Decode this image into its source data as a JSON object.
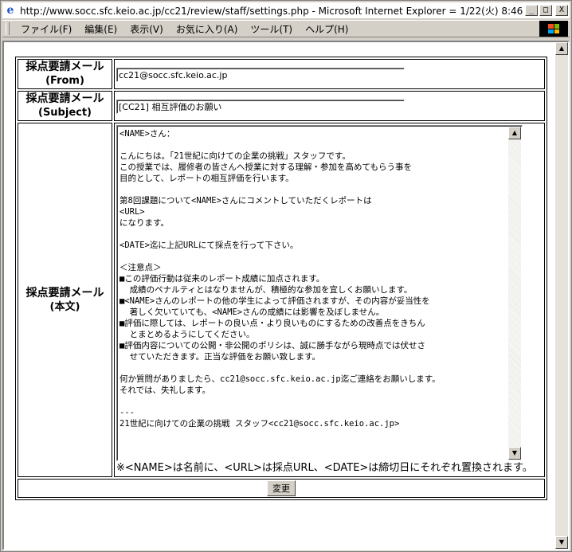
{
  "window": {
    "title": "http://www.socc.sfc.keio.ac.jp/cc21/review/staff/settings.php - Microsoft Internet Explorer = 1/22(火) 8:46",
    "minimize": "_",
    "maximize": "□",
    "close": "X"
  },
  "menu": {
    "items": [
      "ファイル(F)",
      "編集(E)",
      "表示(V)",
      "お気に入り(A)",
      "ツール(T)",
      "ヘルプ(H)"
    ]
  },
  "form": {
    "from_label": "採点要請メール",
    "from_sub": "(From)",
    "from_value": "cc21@socc.sfc.keio.ac.jp",
    "subject_label": "採点要請メール",
    "subject_sub": "(Subject)",
    "subject_value": "[CC21] 相互評価のお願い",
    "body_label": "採点要請メール",
    "body_sub": "(本文)",
    "body_value": "<NAME>さん：\n\nこんにちは。「21世紀に向けての企業の挑戦」スタッフです。\nこの授業では、履修者の皆さんへ授業に対する理解・参加を高めてもらう事を\n目的として、レポートの相互評価を行います。\n\n第8回課題について<NAME>さんにコメントしていただくレポートは\n<URL>\nになります。\n\n<DATE>迄に上記URLにて採点を行って下さい。\n\n＜注意点＞\n■この評価行動は従来のレポート成績に加点されます。\n  成績のペナルティとはなりませんが、積極的な参加を宜しくお願いします。\n■<NAME>さんのレポートの他の学生によって評価されますが、その内容が妥当性を\n  著しく欠いていても、<NAME>さんの成績には影響を及ぼしません。\n■評価に際しては、レポートの良い点・より良いものにするための改善点をきちん\n  とまとめるようにしてください。\n■評価内容についての公開・非公開のポリシは、誠に勝手ながら現時点では伏せさ\n  せていただきます。正当な評価をお願い致します。\n\n何か質問がありましたら、cc21@socc.sfc.keio.ac.jp迄ご連絡をお願いします。\nそれでは、失礼します。\n\n---\n21世紀に向けての企業の挑戦 スタッフ<cc21@socc.sfc.keio.ac.jp>",
    "note": "※<NAME>は名前に、<URL>は採点URL、<DATE>は締切日にそれぞれ置換されます。",
    "submit_label": "変更"
  }
}
